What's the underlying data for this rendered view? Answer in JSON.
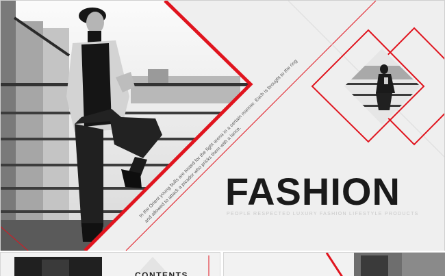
{
  "slide": {
    "slanted_text": "In the Orient young bulls are tested for the fight arena in a certain manner. Each is brought to the ring and allowed to attack a picador who pricks them with a lance.",
    "title": "FASHION",
    "subtitle": "PEOPLE RESPECTED LUXURY FASHION LIFESTYLE PRODUCTS"
  },
  "thumbnails": {
    "contents_title": "CONTENTS"
  },
  "colors": {
    "accent": "#e0141e",
    "title": "#1a1a1a",
    "subtitle": "#c8c8c8",
    "background": "#efefef"
  }
}
